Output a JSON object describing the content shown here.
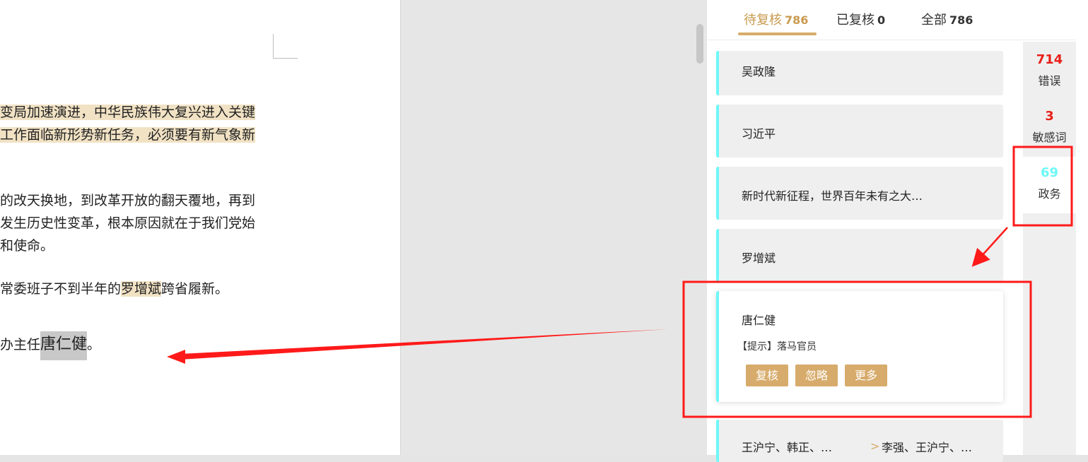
{
  "document": {
    "lines": [
      "变局加速演进，中华民族伟大复兴进入关键",
      "工作面临新形势新任务，必须要有新气象新",
      "的改天换地，到改革开放的翻天覆地，再到",
      "发生历史性变革，根本原因就在于我们党始",
      "和使命。"
    ],
    "line6": {
      "before": "常委班子不到半年的",
      "highlight": "罗增斌",
      "after": "跨省履新。"
    },
    "line7": {
      "before": "办主任",
      "highlight": "唐仁健",
      "after": "。"
    }
  },
  "tabs": [
    {
      "label": "待复核",
      "count": "786",
      "active": true
    },
    {
      "label": "已复核",
      "count": "0",
      "active": false
    },
    {
      "label": "全部",
      "count": "786",
      "active": false
    }
  ],
  "cards": [
    {
      "title": "吴政隆"
    },
    {
      "title": "习近平"
    },
    {
      "title": "新时代新征程，世界百年未有之大…"
    },
    {
      "title": "罗增斌"
    }
  ],
  "expanded_card": {
    "title": "唐仁健",
    "hint": "【提示】落马官员",
    "buttons": [
      "复核",
      "忽略",
      "更多"
    ]
  },
  "last_card": {
    "left": "王沪宁、韩正、…",
    "arrow": ">",
    "right": "李强、王沪宁、…"
  },
  "side": [
    {
      "count": "714",
      "label": "错误"
    },
    {
      "count": "3",
      "label": "敏感词"
    },
    {
      "count": "69",
      "label": "政务"
    }
  ],
  "colors": {
    "accent": "#d7ab6b",
    "cyan": "#6ef7f7",
    "error_red": "#e8201a",
    "annotation_red": "#ff1a1a"
  }
}
